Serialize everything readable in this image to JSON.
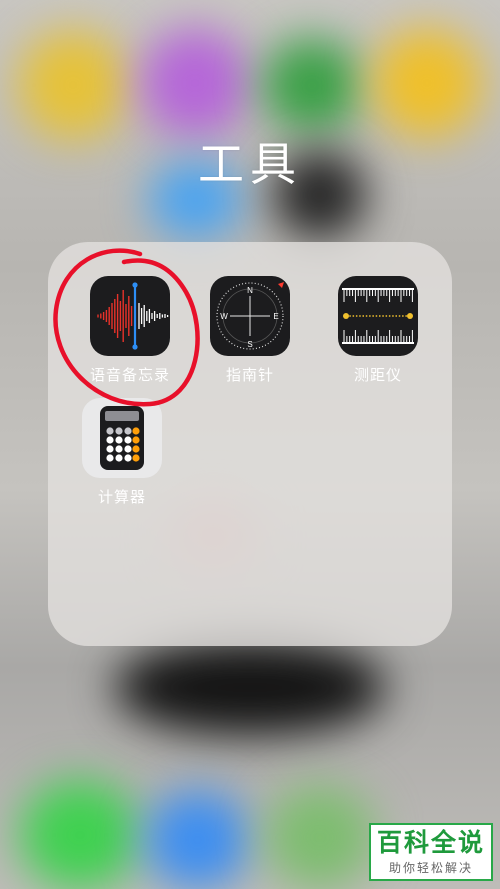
{
  "folder": {
    "title": "工具",
    "apps": [
      {
        "label": "语音备忘录",
        "icon": "voice-memos-icon"
      },
      {
        "label": "指南针",
        "icon": "compass-icon"
      },
      {
        "label": "测距仪",
        "icon": "measure-icon"
      },
      {
        "label": "计算器",
        "icon": "calculator-icon"
      }
    ]
  },
  "compass": {
    "n": "N",
    "e": "E",
    "s": "S",
    "w": "W"
  },
  "watermark": {
    "title": "百科全说",
    "subtitle": "助你轻松解决"
  },
  "colors": {
    "annotation": "#e8102a",
    "wave": "#e8322a",
    "playhead": "#2d8ef5",
    "measure_line": "#f0c02e",
    "watermark_green": "#1f9a3c"
  }
}
